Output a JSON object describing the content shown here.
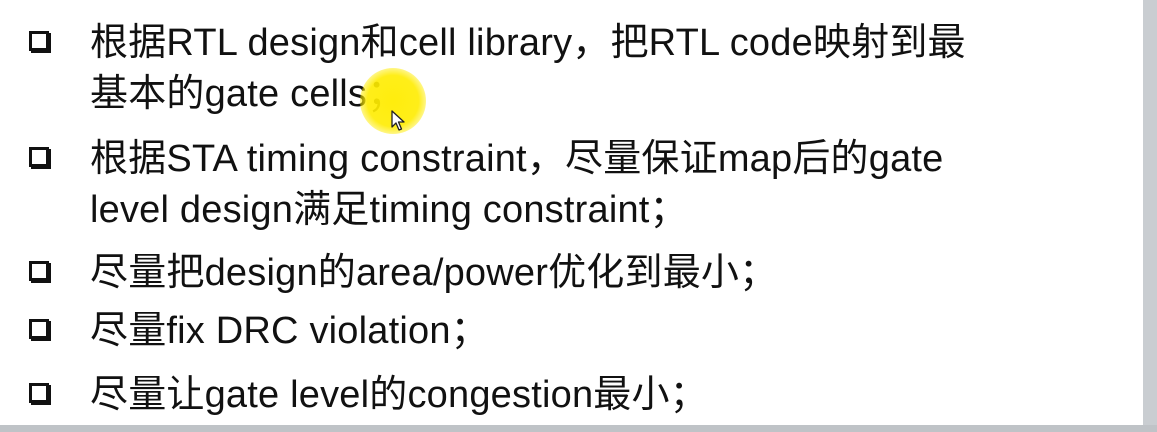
{
  "slide": {
    "items": [
      {
        "lines": [
          "根据RTL design和cell library，把RTL code映射到最",
          "基本的gate cells；"
        ]
      },
      {
        "lines": [
          "根据STA timing constraint，尽量保证map后的gate",
          "level design满足timing constraint；"
        ]
      },
      {
        "lines": [
          "尽量把design的area/power优化到最小；"
        ]
      },
      {
        "lines": [
          "尽量fix DRC violation；"
        ]
      },
      {
        "lines": [
          "尽量让gate level的congestion最小；"
        ]
      }
    ],
    "bullet_icon": "checkbox-icon",
    "cursor_icon": "arrow-pointer-icon",
    "highlight_color": "#ffec00"
  }
}
